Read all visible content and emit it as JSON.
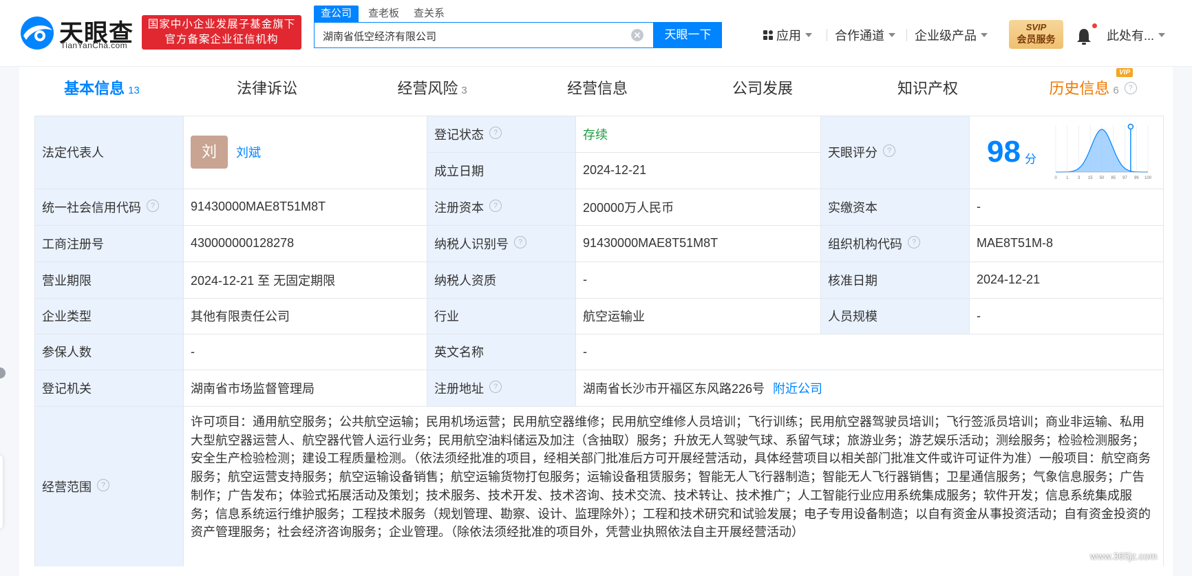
{
  "header": {
    "logo_cn": "天眼查",
    "logo_en": "TianYanCha.com",
    "badge_line1": "国家中小企业发展子基金旗下",
    "badge_line2": "官方备案企业征信机构",
    "search_tabs": [
      "查公司",
      "查老板",
      "查关系"
    ],
    "search_value": "湖南省低空经济有限公司",
    "search_button": "天眼一下",
    "nav": [
      "应用",
      "合作通道",
      "企业级产品"
    ],
    "svip_line1": "SVIP",
    "svip_line2": "会员服务",
    "user": "此处有..."
  },
  "tabs": [
    {
      "label": "基本信息",
      "count": "13"
    },
    {
      "label": "法律诉讼",
      "count": ""
    },
    {
      "label": "经营风险",
      "count": "3"
    },
    {
      "label": "经营信息",
      "count": ""
    },
    {
      "label": "公司发展",
      "count": ""
    },
    {
      "label": "知识产权",
      "count": ""
    },
    {
      "label": "历史信息",
      "count": "6",
      "badge": "VIP"
    }
  ],
  "info": {
    "legal_rep_label": "法定代表人",
    "legal_rep_avatar": "刘",
    "legal_rep_name": "刘斌",
    "reg_status_label": "登记状态",
    "reg_status": "存续",
    "found_date_label": "成立日期",
    "found_date": "2024-12-21",
    "score_label": "天眼评分",
    "score": "98",
    "score_unit": "分",
    "credit_code_label": "统一社会信用代码",
    "credit_code": "91430000MAE8T51M8T",
    "reg_capital_label": "注册资本",
    "reg_capital": "200000万人民币",
    "paid_capital_label": "实缴资本",
    "paid_capital": "-",
    "biz_reg_no_label": "工商注册号",
    "biz_reg_no": "430000000128278",
    "tax_id_label": "纳税人识别号",
    "tax_id": "91430000MAE8T51M8T",
    "org_code_label": "组织机构代码",
    "org_code": "MAE8T51M-8",
    "term_label": "营业期限",
    "term": "2024-12-21 至 无固定期限",
    "taxpayer_label": "纳税人资质",
    "taxpayer": "-",
    "approve_date_label": "核准日期",
    "approve_date": "2024-12-21",
    "type_label": "企业类型",
    "type": "其他有限责任公司",
    "industry_label": "行业",
    "industry": "航空运输业",
    "staff_label": "人员规模",
    "staff": "-",
    "insured_label": "参保人数",
    "insured": "-",
    "en_name_label": "英文名称",
    "en_name": "-",
    "authority_label": "登记机关",
    "authority": "湖南省市场监督管理局",
    "address_label": "注册地址",
    "address": "湖南省长沙市开福区东风路226号",
    "nearby": "附近公司",
    "scope_label": "经营范围",
    "scope": "许可项目：通用航空服务；公共航空运输；民用机场运营；民用航空器维修；民用航空维修人员培训；飞行训练；民用航空器驾驶员培训；飞行签派员培训；商业非运输、私用大型航空器运营人、航空器代管人运行业务；民用航空油料储运及加注（含抽取）服务；升放无人驾驶气球、系留气球；旅游业务；游艺娱乐活动；测绘服务；检验检测服务；安全生产检验检测；建设工程质量检测。（依法须经批准的项目，经相关部门批准后方可开展经营活动，具体经营项目以相关部门批准文件或许可证件为准）一般项目：航空商务服务；航空运营支持服务；航空运输设备销售；航空运输货物打包服务；运输设备租赁服务；智能无人飞行器制造；智能无人飞行器销售；卫星通信服务；气象信息服务；广告制作；广告发布；体验式拓展活动及策划；技术服务、技术开发、技术咨询、技术交流、技术转让、技术推广；人工智能行业应用系统集成服务；软件开发；信息系统集成服务；信息系统运行维护服务；工程技术服务（规划管理、勘察、设计、监理除外）；工程和技术研究和试验发展；电子专用设备制造；以自有资金从事投资活动；自有资金投资的资产管理服务；社会经济咨询服务；企业管理。（除依法须经批准的项目外，凭营业执照依法自主开展经营活动）"
  },
  "score_chart_ticks": [
    "0",
    "1",
    "3",
    "15",
    "50",
    "85",
    "97",
    "99",
    "100"
  ],
  "watermark": "www.365jz.com",
  "colors": {
    "accent": "#0084ff",
    "label_bg": "#eaf2fd",
    "status_green": "#1e9b3f",
    "badge_red": "#e12830",
    "history_orange": "#f07800"
  }
}
